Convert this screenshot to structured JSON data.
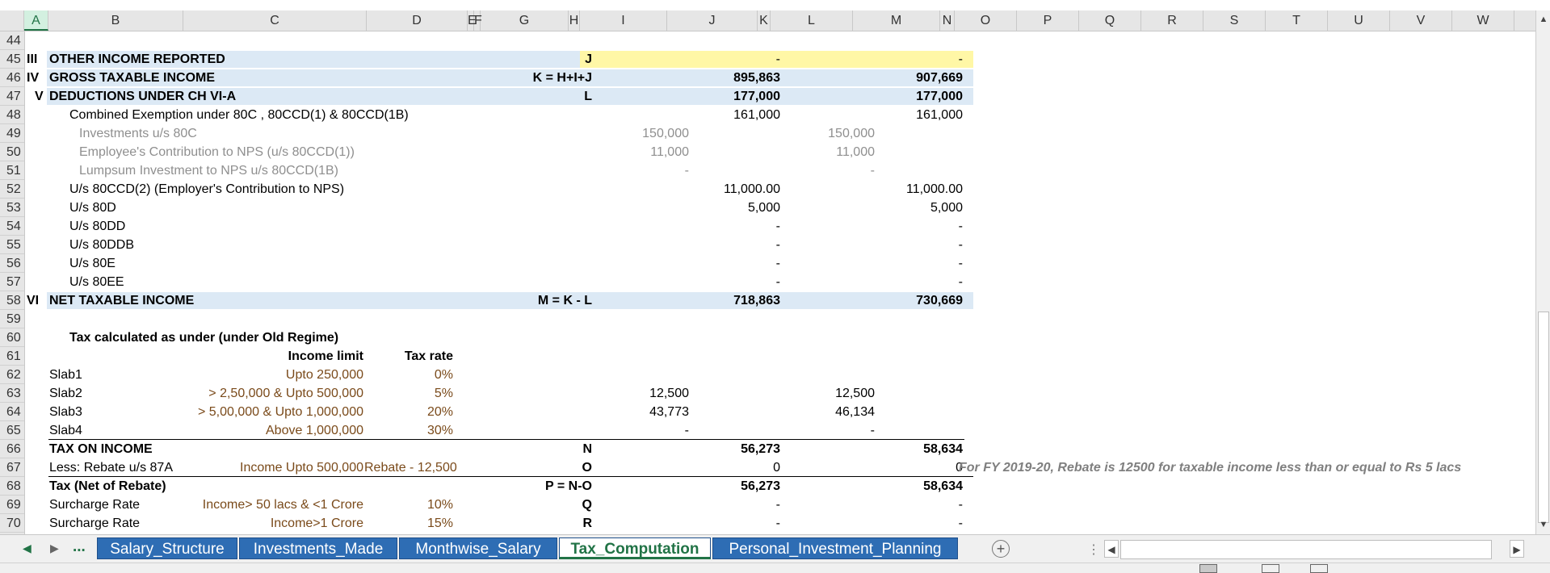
{
  "columns": [
    "A",
    "B",
    "C",
    "D",
    "E",
    "F",
    "G",
    "H",
    "I",
    "J",
    "K",
    "L",
    "M",
    "N",
    "O",
    "P",
    "Q",
    "R",
    "S",
    "T",
    "U",
    "V",
    "W"
  ],
  "selected_column": "A",
  "rows": [
    "44",
    "45",
    "46",
    "47",
    "48",
    "49",
    "50",
    "51",
    "52",
    "53",
    "54",
    "55",
    "56",
    "57",
    "58",
    "59",
    "60",
    "61",
    "62",
    "63",
    "64",
    "65",
    "66",
    "67",
    "68",
    "69",
    "70"
  ],
  "sheet": {
    "r45": {
      "roman": "III",
      "label": "OTHER INCOME REPORTED",
      "formula": "J",
      "j": "-",
      "m": "-"
    },
    "r46": {
      "roman": "IV",
      "label": "GROSS TAXABLE INCOME",
      "formula": "K = H+I+J",
      "j": "895,863",
      "m": "907,669"
    },
    "r47": {
      "roman": "V",
      "label": "DEDUCTIONS UNDER CH VI-A",
      "formula": "L",
      "j": "177,000",
      "m": "177,000"
    },
    "r48": {
      "label": "Combined Exemption under 80C , 80CCD(1) & 80CCD(1B)",
      "j": "161,000",
      "m": "161,000"
    },
    "r49": {
      "label": "Investments u/s 80C",
      "i": "150,000",
      "l": "150,000"
    },
    "r50": {
      "label": "Employee's Contribution to NPS (u/s 80CCD(1))",
      "i": "11,000",
      "l": "11,000"
    },
    "r51": {
      "label": "Lumpsum Investment to NPS u/s 80CCD(1B)",
      "i": "-",
      "l": "-"
    },
    "r52": {
      "label": "U/s 80CCD(2) (Employer's Contribution to NPS)",
      "j": "11,000.00",
      "m": "11,000.00"
    },
    "r53": {
      "label": "U/s 80D",
      "j": "5,000",
      "m": "5,000"
    },
    "r54": {
      "label": "U/s 80DD",
      "j": "-",
      "m": "-"
    },
    "r55": {
      "label": "U/s 80DDB",
      "j": "-",
      "m": "-"
    },
    "r56": {
      "label": "U/s 80E",
      "j": "-",
      "m": "-"
    },
    "r57": {
      "label": "U/s 80EE",
      "j": "-",
      "m": "-"
    },
    "r58": {
      "roman": "VI",
      "label": "NET TAXABLE INCOME",
      "formula": "M = K - L",
      "j": "718,863",
      "m": "730,669"
    },
    "r60": {
      "label": "Tax calculated as under (under Old Regime)"
    },
    "r61": {
      "income_limit": "Income limit",
      "tax_rate": "Tax rate"
    },
    "r62": {
      "label": "Slab1",
      "limit": "Upto 250,000",
      "rate": "0%"
    },
    "r63": {
      "label": "Slab2",
      "limit": "> 2,50,000 & Upto 500,000",
      "rate": "5%",
      "i": "12,500",
      "l": "12,500"
    },
    "r64": {
      "label": "Slab3",
      "limit": "> 5,00,000 & Upto 1,000,000",
      "rate": "20%",
      "i": "43,773",
      "l": "46,134"
    },
    "r65": {
      "label": "Slab4",
      "limit": "Above 1,000,000",
      "rate": "30%",
      "i": "-",
      "l": "-"
    },
    "r66": {
      "label": "TAX ON INCOME",
      "formula": "N",
      "j": "56,273",
      "m": "58,634"
    },
    "r67": {
      "label": "Less: Rebate u/s 87A",
      "limit": "Income Upto 500,000",
      "rate": "Rebate - 12,500",
      "formula": "O",
      "j": "0",
      "m": "0",
      "note": "For FY 2019-20, Rebate is 12500 for taxable income less than or equal to Rs 5 lacs"
    },
    "r68": {
      "label": "Tax (Net of Rebate)",
      "formula": "P = N-O",
      "j": "56,273",
      "m": "58,634"
    },
    "r69": {
      "label": "Surcharge Rate",
      "limit": "Income> 50 lacs & <1 Crore",
      "rate": "10%",
      "formula": "Q",
      "j": "-",
      "m": "-"
    },
    "r70": {
      "label": "Surcharge Rate",
      "limit": "Income>1 Crore",
      "rate": "15%",
      "formula": "R",
      "j": "-",
      "m": "-"
    }
  },
  "tabs": {
    "more": "...",
    "t1": "Salary_Structure",
    "t2": "Investments_Made",
    "t3": "Monthwise_Salary",
    "t4": "Tax_Computation",
    "t5": "Personal_Investment_Planning",
    "active": "Tax_Computation"
  },
  "icons": {
    "nav_prev": "triangle-left-icon",
    "nav_next": "triangle-right-icon",
    "add_sheet": "plus-circle-icon"
  },
  "colors": {
    "band": "#dce9f5",
    "yellow": "#fff7a6",
    "tab": "#2e6db4",
    "accent": "#217346"
  }
}
